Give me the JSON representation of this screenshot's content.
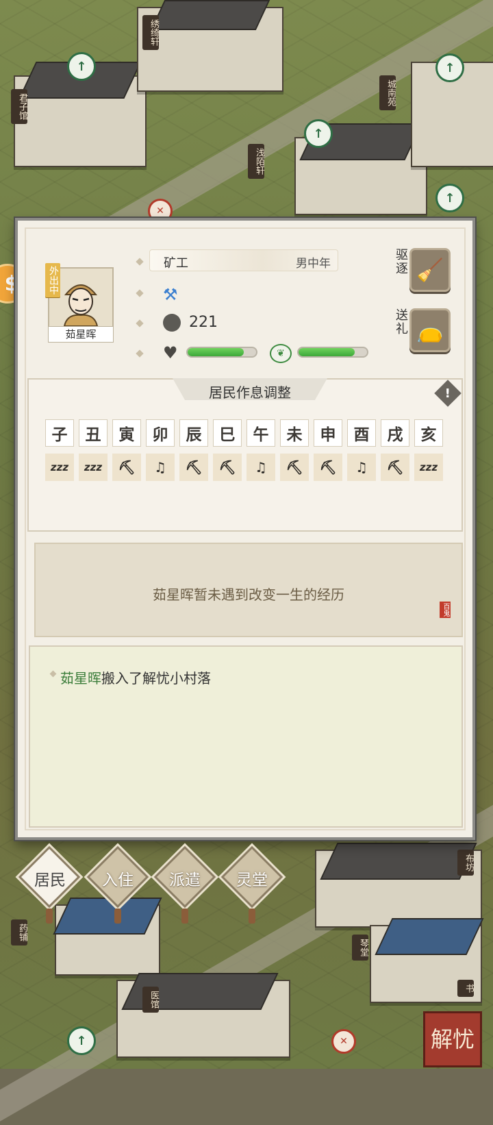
{
  "map": {
    "signs": [
      "君子馆",
      "绣绮轩",
      "浅陌轩",
      "城南苑",
      "布坊",
      "药铺",
      "琴堂",
      "医馆",
      "书"
    ],
    "corner_button": "解忧"
  },
  "resident": {
    "name": "茹星晖",
    "status_tag": "外出中",
    "job": "矿工",
    "age_group": "男中年",
    "wealth": "221",
    "health_fraction": 0.82,
    "mood_fraction": 0.82,
    "actions": {
      "expel": "驱逐",
      "gift": "送礼"
    }
  },
  "schedule": {
    "title": "居民作息调整",
    "hours": [
      "子",
      "丑",
      "寅",
      "卯",
      "辰",
      "巳",
      "午",
      "未",
      "申",
      "酉",
      "戌",
      "亥"
    ],
    "activities": [
      {
        "icon": "sleep-icon",
        "glyph": "zzz"
      },
      {
        "icon": "sleep-icon",
        "glyph": "zzz"
      },
      {
        "icon": "pickaxe-icon",
        "glyph": "⛏"
      },
      {
        "icon": "leisure-icon",
        "glyph": "♫"
      },
      {
        "icon": "pickaxe-icon",
        "glyph": "⛏"
      },
      {
        "icon": "pickaxe-icon",
        "glyph": "⛏"
      },
      {
        "icon": "leisure-icon",
        "glyph": "♫"
      },
      {
        "icon": "pickaxe-icon",
        "glyph": "⛏"
      },
      {
        "icon": "pickaxe-icon",
        "glyph": "⛏"
      },
      {
        "icon": "leisure-icon",
        "glyph": "♫"
      },
      {
        "icon": "pickaxe-icon",
        "glyph": "⛏"
      },
      {
        "icon": "sleep-icon",
        "glyph": "zzz"
      }
    ]
  },
  "story": {
    "text": "茹星晖暂未遇到改变一生的经历",
    "seal": "百鬼"
  },
  "log": {
    "name": "茹星晖",
    "text": "搬入了解忧小村落"
  },
  "tabs": [
    {
      "label": "居民",
      "active": true
    },
    {
      "label": "入住",
      "active": false
    },
    {
      "label": "派遣",
      "active": false
    },
    {
      "label": "灵堂",
      "active": false
    }
  ]
}
